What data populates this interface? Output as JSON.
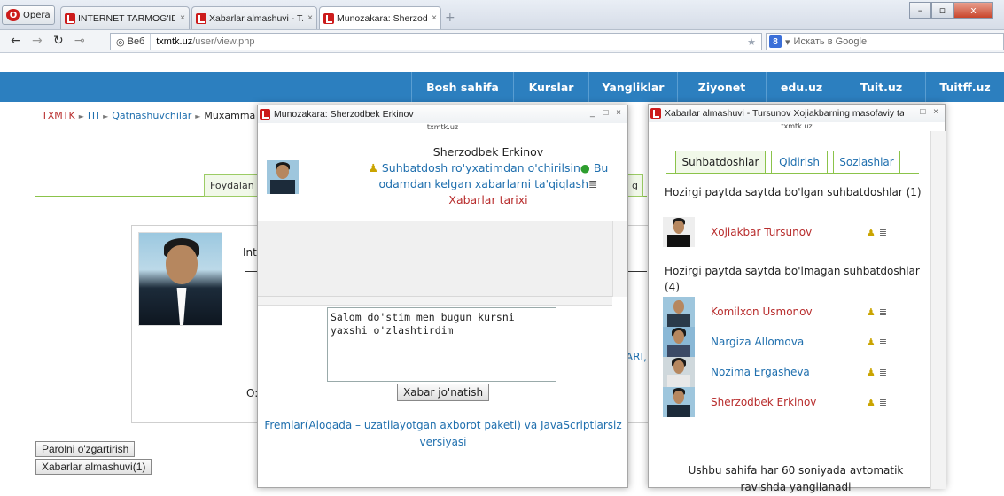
{
  "browser": {
    "menu_label": "Opera",
    "tabs": [
      {
        "title": "INTERNET TARMOG'ID...",
        "close": "×"
      },
      {
        "title": "Xabarlar almashuvi - T...",
        "close": "×"
      },
      {
        "title": "Munozakara: Sherzodb...",
        "close": "×"
      }
    ],
    "new_tab": "+",
    "window_controls": {
      "minimize": "–",
      "maximize": "▫",
      "close": "x"
    },
    "web_tag": "Веб",
    "url_host": "txmtk.uz",
    "url_path": "/user/view.php",
    "search_placeholder": "Искать в Google",
    "nav_back": "←",
    "nav_forward": "→",
    "nav_reload": "↻",
    "nav_key": "⊸"
  },
  "site": {
    "nav": [
      "Bosh sahifa",
      "Kurslar",
      "Yangliklar",
      "Ziyonet",
      "edu.uz",
      "Tuit.uz",
      "Tuitff.uz"
    ],
    "breadcrumb": [
      "TXMTK",
      "ITI",
      "Qatnashuvchilar",
      "Muxamma"
    ],
    "breadcrumb_sep": "►",
    "profile_tabs": [
      "Foydalan",
      "g"
    ],
    "profile_text_fragments": {
      "int": "Int",
      "ari": "ARI,",
      "o": "O:"
    },
    "buttons": {
      "change_password": "Parolni o'zgartirish",
      "messages": "Xabarlar almashuvi(1)"
    }
  },
  "chat_window": {
    "title": "Munozakara: Sherzodbek Erkinov",
    "domain": "txmtk.uz",
    "controls": "_ □ ×",
    "contact_name": "Sherzodbek Erkinov",
    "action_remove": "Suhbatdosh ro'yxatimdan o'chirilsin",
    "action_block": "Bu odamdan kelgan xabarlarni ta'qiqlash",
    "action_history": "Xabarlar tarixi",
    "message_text": "Salom do'stim men bugun kursni yaxshi o'zlashtirdim",
    "send_label": "Xabar jo'natish",
    "frames_link": "Fremlar(Aloqada – uzatilayotgan axborot paketi) va JavaScriptlarsiz versiyasi"
  },
  "messaging_window": {
    "title": "Xabarlar almashuvi - Tursunov Xojiakbarning masofaviy ta'lim k...",
    "domain": "txmtk.uz",
    "controls": "□ ×",
    "tabs": [
      "Suhbatdoshlar",
      "Qidirish",
      "Sozlashlar"
    ],
    "online_heading": "Hozirgi paytda saytda bo'lgan suhbatdoshlar (1)",
    "online_users": [
      {
        "name": "Xojiakbar Tursunov",
        "color": "#b82d2d"
      }
    ],
    "offline_heading": "Hozirgi paytda saytda bo'lmagan suhbatdoshlar (4)",
    "offline_users": [
      {
        "name": "Komilxon Usmonov",
        "color": "#b82d2d"
      },
      {
        "name": "Nargiza Allomova",
        "color": "#1f6fae"
      },
      {
        "name": "Nozima Ergasheva",
        "color": "#1f6fae"
      },
      {
        "name": "Sherzodbek Erkinov",
        "color": "#b82d2d"
      }
    ],
    "refresh_note": "Ushbu sahifa har 60 soniyada avtomatik ravishda yangilanadi"
  },
  "icons": {
    "contact": "person-icon",
    "history": "document-icon",
    "allow": "green-circle-icon"
  },
  "colors": {
    "nav_bg": "#2c7fbf",
    "link": "#1f6fae",
    "accent_red": "#b82d2d",
    "tab_green": "#8bc34a"
  }
}
